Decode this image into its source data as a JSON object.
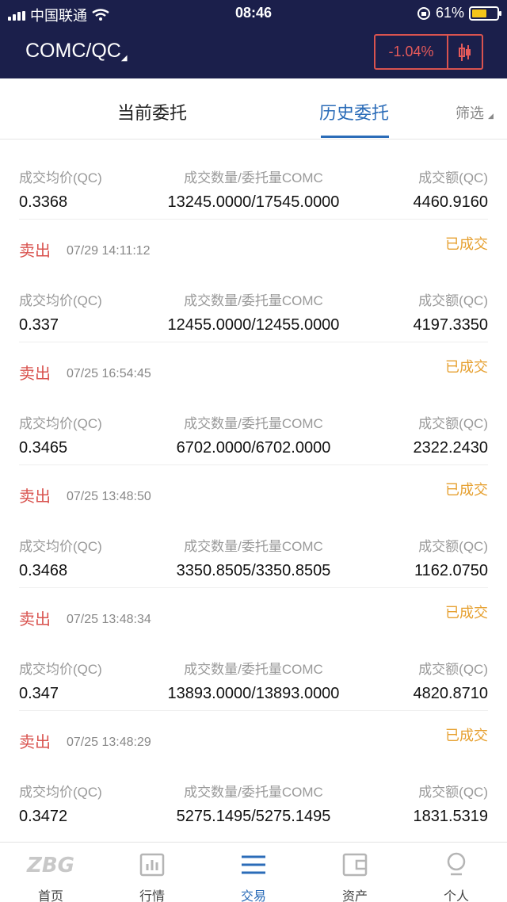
{
  "status_bar": {
    "carrier": "中国联通",
    "time": "08:46",
    "battery": "61%"
  },
  "header": {
    "pair": "COMC/QC",
    "change": "-1.04%"
  },
  "tabs": {
    "current": "当前委托",
    "history": "历史委托",
    "filter": "筛选"
  },
  "labels": {
    "avg_price": "成交均价(QC)",
    "quantity": "成交数量/委托量COMC",
    "amount": "成交额(QC)"
  },
  "orders": [
    {
      "avg_price": "0.3368",
      "quantity": "13245.0000/17545.0000",
      "amount": "4460.9160",
      "side": "卖出",
      "time": "07/29 14:11:12",
      "status": "已成交"
    },
    {
      "avg_price": "0.337",
      "quantity": "12455.0000/12455.0000",
      "amount": "4197.3350",
      "side": "卖出",
      "time": "07/25 16:54:45",
      "status": "已成交"
    },
    {
      "avg_price": "0.3465",
      "quantity": "6702.0000/6702.0000",
      "amount": "2322.2430",
      "side": "卖出",
      "time": "07/25 13:48:50",
      "status": "已成交"
    },
    {
      "avg_price": "0.3468",
      "quantity": "3350.8505/3350.8505",
      "amount": "1162.0750",
      "side": "卖出",
      "time": "07/25 13:48:34",
      "status": "已成交"
    },
    {
      "avg_price": "0.347",
      "quantity": "13893.0000/13893.0000",
      "amount": "4820.8710",
      "side": "卖出",
      "time": "07/25 13:48:29",
      "status": "已成交"
    },
    {
      "avg_price": "0.3472",
      "quantity": "5275.1495/5275.1495",
      "amount": "1831.5319",
      "side": "",
      "time": "",
      "status": ""
    }
  ],
  "nav": {
    "home": "首页",
    "market": "行情",
    "trade": "交易",
    "assets": "资产",
    "profile": "个人",
    "logo_text": "ZBG"
  },
  "colors": {
    "header_bg": "#1b1f4b",
    "accent": "#2b6cb8",
    "sell": "#d9534f",
    "filled": "#e6a030"
  }
}
